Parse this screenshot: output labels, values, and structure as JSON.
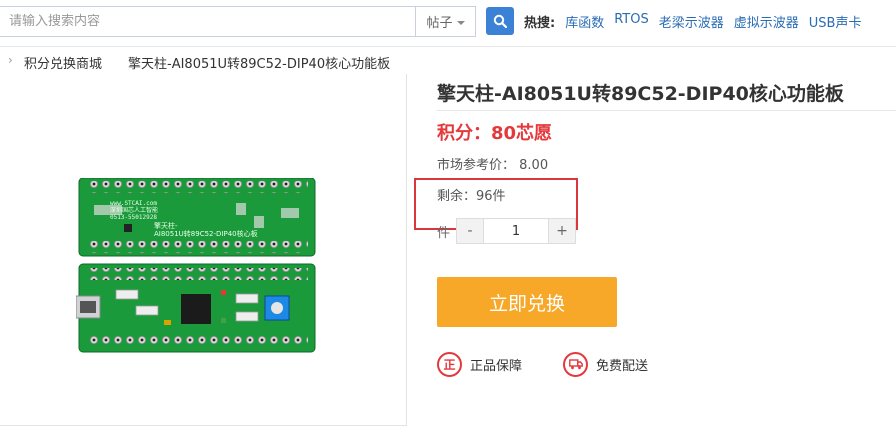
{
  "search": {
    "placeholder": "请输入搜索内容",
    "type_selected": "帖子",
    "hot_label": "热搜:",
    "hot_links": [
      "库函数",
      "RTOS",
      "老梁示波器",
      "虚拟示波器",
      "USB声卡"
    ]
  },
  "breadcrumb": {
    "separator": "›",
    "items": [
      "积分兑换商城",
      "擎天柱-AI8051U转89C52-DIP40核心功能板"
    ]
  },
  "product": {
    "title": "擎天柱-AI8051U转89C52-DIP40核心功能板",
    "points_text": "积分：80芯愿",
    "market_price_label": "市场参考价：",
    "market_price": "8.00",
    "stock_text": "剩余：96件",
    "qty_label": "件",
    "qty_minus": "-",
    "qty_value": "1",
    "qty_plus": "+",
    "redeem_label": "立即兑换",
    "guarantees": [
      {
        "icon": "正",
        "label": "正品保障"
      },
      {
        "icon": "🚚",
        "label": "免费配送"
      }
    ],
    "board_silkscreen": [
      "www.STCAI.com",
      "深圳国芯人工智能",
      "0513-55012928",
      "擎天柱-",
      "AI8051U转89C52-DIP40核心板"
    ]
  },
  "colors": {
    "accent_blue": "#3b82d6",
    "link_blue": "#2a6cb4",
    "price_red": "#e4393c",
    "redeem_orange": "#f7a829",
    "pcb_green": "#1a9a3a"
  }
}
